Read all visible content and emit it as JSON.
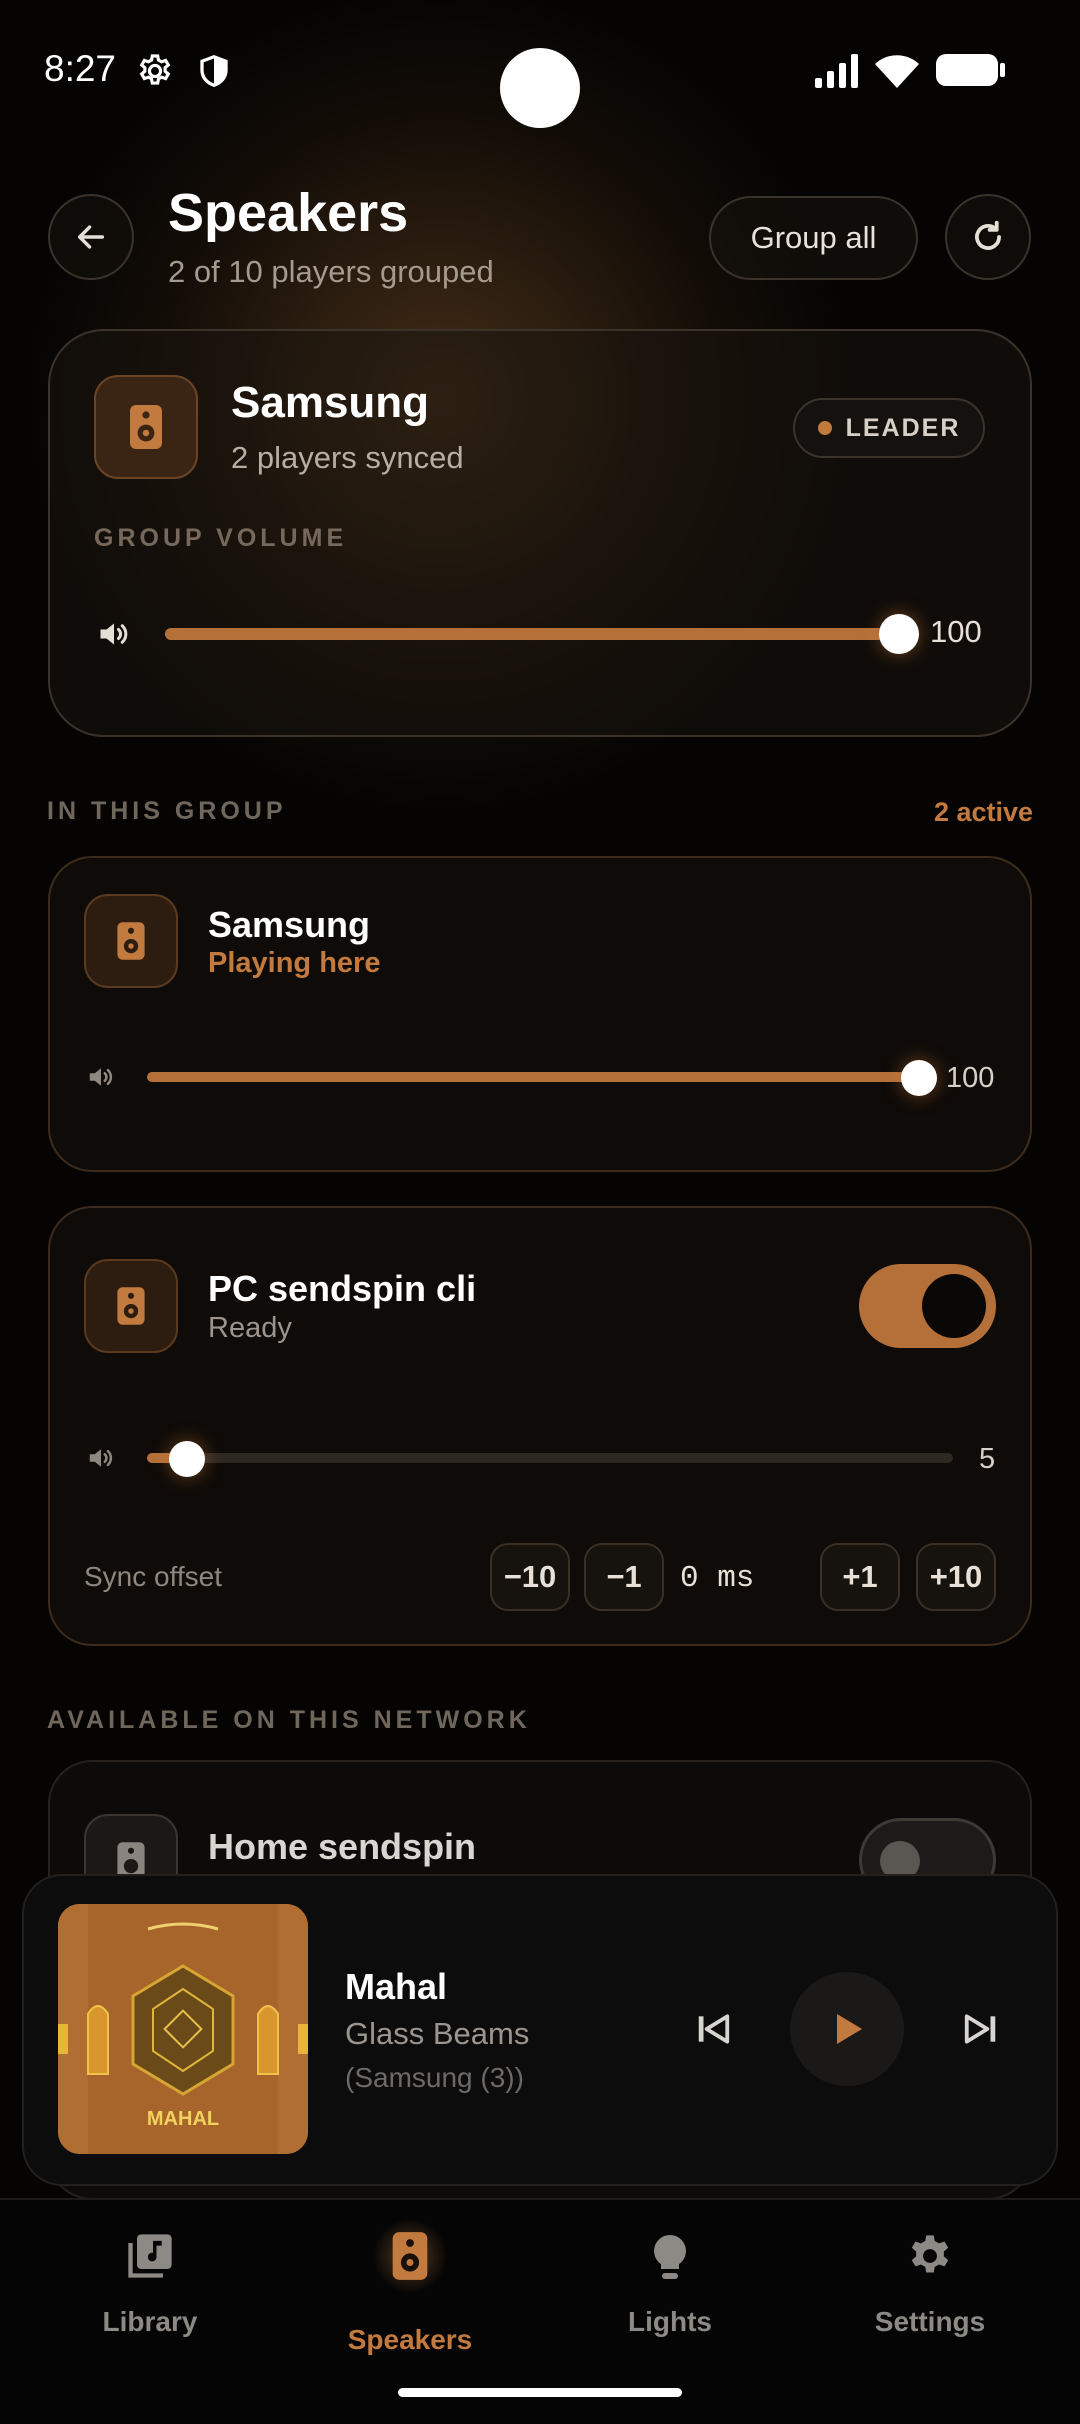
{
  "status_bar": {
    "time": "8:27",
    "icons": [
      "gear-icon",
      "shield-icon",
      "signal-icon",
      "wifi-icon",
      "battery-icon"
    ]
  },
  "header": {
    "title": "Speakers",
    "subtitle": "2 of 10 players grouped",
    "group_all_label": "Group all",
    "icons": [
      "back-arrow-icon",
      "refresh-icon"
    ]
  },
  "group_card": {
    "name": "Samsung",
    "status": "2 players synced",
    "badge": "LEADER",
    "volume_label": "GROUP VOLUME",
    "volume": "100",
    "volume_fraction": 1.0
  },
  "in_group": {
    "label": "IN THIS GROUP",
    "active_count": "2 active",
    "players": [
      {
        "name": "Samsung",
        "status": "Playing here",
        "volume": "100",
        "volume_fraction": 1.0
      },
      {
        "name": "PC sendspin cli",
        "status": "Ready",
        "volume": "5",
        "volume_fraction": 0.05,
        "toggle_on": true,
        "sync_offset": {
          "label": "Sync offset",
          "value": "0 ms",
          "buttons": [
            "−10",
            "−1",
            "+1",
            "+10"
          ]
        }
      }
    ]
  },
  "available": {
    "label": "AVAILABLE ON THIS NETWORK",
    "players": [
      {
        "name": "Home sendspin",
        "toggle_on": false
      }
    ]
  },
  "now_playing": {
    "title": "Mahal",
    "artist": "Glass Beams",
    "device": "(Samsung (3))",
    "album_text": "MAHAL",
    "icons": [
      "previous-icon",
      "play-icon",
      "next-icon"
    ]
  },
  "nav": {
    "items": [
      {
        "label": "Library",
        "icon": "library-icon",
        "active": false
      },
      {
        "label": "Speakers",
        "icon": "speaker-icon",
        "active": true
      },
      {
        "label": "Lights",
        "icon": "lightbulb-icon",
        "active": false
      },
      {
        "label": "Settings",
        "icon": "settings-icon",
        "active": false
      }
    ]
  },
  "colors": {
    "accent": "#b5703a",
    "accent_text": "#c27a3e",
    "background": "#050403"
  }
}
